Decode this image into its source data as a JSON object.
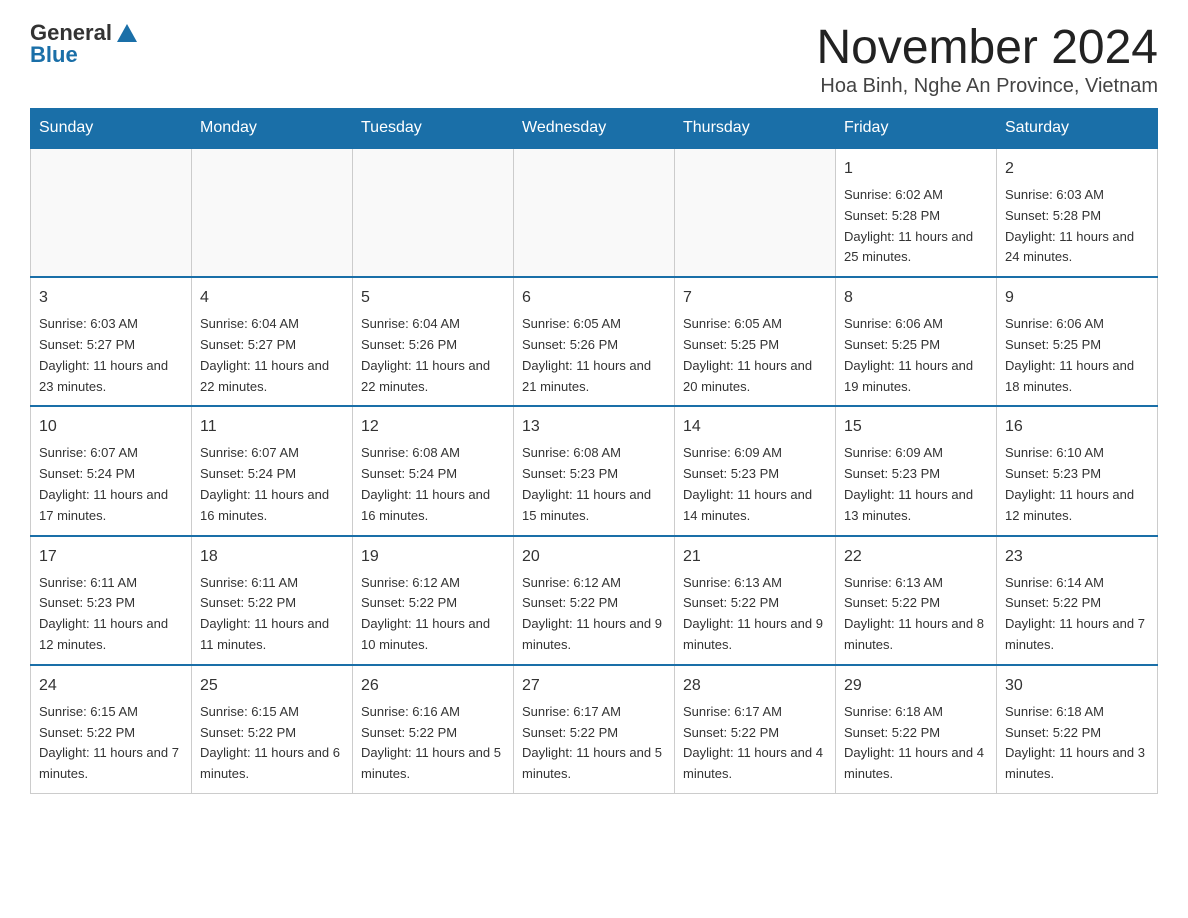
{
  "header": {
    "logo": {
      "general": "General",
      "blue": "Blue"
    },
    "title": "November 2024",
    "location": "Hoa Binh, Nghe An Province, Vietnam"
  },
  "calendar": {
    "days_of_week": [
      "Sunday",
      "Monday",
      "Tuesday",
      "Wednesday",
      "Thursday",
      "Friday",
      "Saturday"
    ],
    "weeks": [
      [
        {
          "day": "",
          "info": ""
        },
        {
          "day": "",
          "info": ""
        },
        {
          "day": "",
          "info": ""
        },
        {
          "day": "",
          "info": ""
        },
        {
          "day": "",
          "info": ""
        },
        {
          "day": "1",
          "info": "Sunrise: 6:02 AM\nSunset: 5:28 PM\nDaylight: 11 hours and 25 minutes."
        },
        {
          "day": "2",
          "info": "Sunrise: 6:03 AM\nSunset: 5:28 PM\nDaylight: 11 hours and 24 minutes."
        }
      ],
      [
        {
          "day": "3",
          "info": "Sunrise: 6:03 AM\nSunset: 5:27 PM\nDaylight: 11 hours and 23 minutes."
        },
        {
          "day": "4",
          "info": "Sunrise: 6:04 AM\nSunset: 5:27 PM\nDaylight: 11 hours and 22 minutes."
        },
        {
          "day": "5",
          "info": "Sunrise: 6:04 AM\nSunset: 5:26 PM\nDaylight: 11 hours and 22 minutes."
        },
        {
          "day": "6",
          "info": "Sunrise: 6:05 AM\nSunset: 5:26 PM\nDaylight: 11 hours and 21 minutes."
        },
        {
          "day": "7",
          "info": "Sunrise: 6:05 AM\nSunset: 5:25 PM\nDaylight: 11 hours and 20 minutes."
        },
        {
          "day": "8",
          "info": "Sunrise: 6:06 AM\nSunset: 5:25 PM\nDaylight: 11 hours and 19 minutes."
        },
        {
          "day": "9",
          "info": "Sunrise: 6:06 AM\nSunset: 5:25 PM\nDaylight: 11 hours and 18 minutes."
        }
      ],
      [
        {
          "day": "10",
          "info": "Sunrise: 6:07 AM\nSunset: 5:24 PM\nDaylight: 11 hours and 17 minutes."
        },
        {
          "day": "11",
          "info": "Sunrise: 6:07 AM\nSunset: 5:24 PM\nDaylight: 11 hours and 16 minutes."
        },
        {
          "day": "12",
          "info": "Sunrise: 6:08 AM\nSunset: 5:24 PM\nDaylight: 11 hours and 16 minutes."
        },
        {
          "day": "13",
          "info": "Sunrise: 6:08 AM\nSunset: 5:23 PM\nDaylight: 11 hours and 15 minutes."
        },
        {
          "day": "14",
          "info": "Sunrise: 6:09 AM\nSunset: 5:23 PM\nDaylight: 11 hours and 14 minutes."
        },
        {
          "day": "15",
          "info": "Sunrise: 6:09 AM\nSunset: 5:23 PM\nDaylight: 11 hours and 13 minutes."
        },
        {
          "day": "16",
          "info": "Sunrise: 6:10 AM\nSunset: 5:23 PM\nDaylight: 11 hours and 12 minutes."
        }
      ],
      [
        {
          "day": "17",
          "info": "Sunrise: 6:11 AM\nSunset: 5:23 PM\nDaylight: 11 hours and 12 minutes."
        },
        {
          "day": "18",
          "info": "Sunrise: 6:11 AM\nSunset: 5:22 PM\nDaylight: 11 hours and 11 minutes."
        },
        {
          "day": "19",
          "info": "Sunrise: 6:12 AM\nSunset: 5:22 PM\nDaylight: 11 hours and 10 minutes."
        },
        {
          "day": "20",
          "info": "Sunrise: 6:12 AM\nSunset: 5:22 PM\nDaylight: 11 hours and 9 minutes."
        },
        {
          "day": "21",
          "info": "Sunrise: 6:13 AM\nSunset: 5:22 PM\nDaylight: 11 hours and 9 minutes."
        },
        {
          "day": "22",
          "info": "Sunrise: 6:13 AM\nSunset: 5:22 PM\nDaylight: 11 hours and 8 minutes."
        },
        {
          "day": "23",
          "info": "Sunrise: 6:14 AM\nSunset: 5:22 PM\nDaylight: 11 hours and 7 minutes."
        }
      ],
      [
        {
          "day": "24",
          "info": "Sunrise: 6:15 AM\nSunset: 5:22 PM\nDaylight: 11 hours and 7 minutes."
        },
        {
          "day": "25",
          "info": "Sunrise: 6:15 AM\nSunset: 5:22 PM\nDaylight: 11 hours and 6 minutes."
        },
        {
          "day": "26",
          "info": "Sunrise: 6:16 AM\nSunset: 5:22 PM\nDaylight: 11 hours and 5 minutes."
        },
        {
          "day": "27",
          "info": "Sunrise: 6:17 AM\nSunset: 5:22 PM\nDaylight: 11 hours and 5 minutes."
        },
        {
          "day": "28",
          "info": "Sunrise: 6:17 AM\nSunset: 5:22 PM\nDaylight: 11 hours and 4 minutes."
        },
        {
          "day": "29",
          "info": "Sunrise: 6:18 AM\nSunset: 5:22 PM\nDaylight: 11 hours and 4 minutes."
        },
        {
          "day": "30",
          "info": "Sunrise: 6:18 AM\nSunset: 5:22 PM\nDaylight: 11 hours and 3 minutes."
        }
      ]
    ]
  }
}
